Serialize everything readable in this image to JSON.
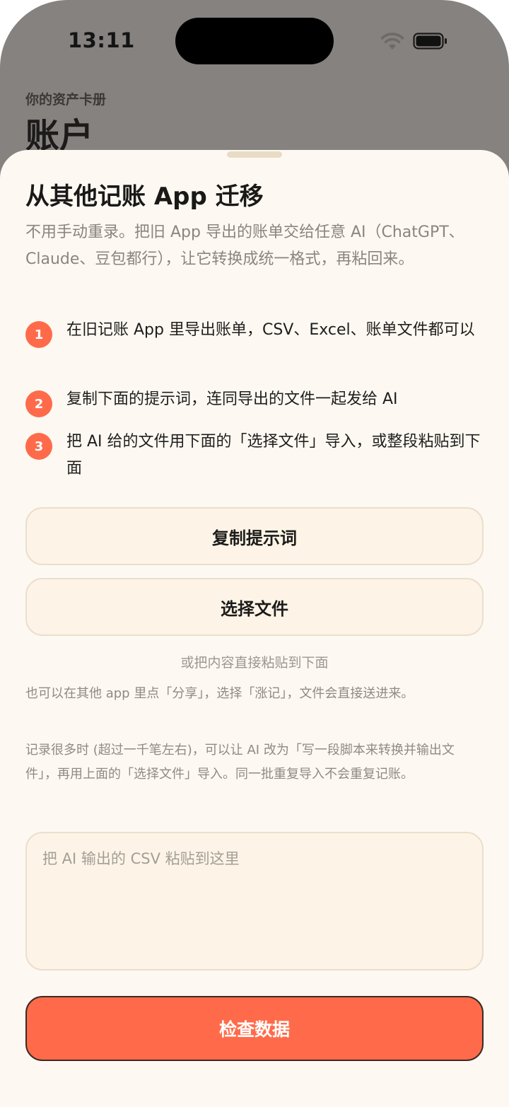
{
  "status_bar": {
    "time": "13:11"
  },
  "background_page": {
    "subtitle": "你的资产卡册",
    "title": "账户"
  },
  "sheet": {
    "title": "从其他记账 App 迁移",
    "intro": "不用手动重录。把旧 App 导出的账单交给任意 AI（ChatGPT、Claude、豆包都行），让它转换成统一格式，再粘回来。",
    "steps": [
      {
        "num": "1",
        "text": "在旧记账 App 里导出账单，CSV、Excel、账单文件都可以"
      },
      {
        "num": "2",
        "text": "复制下面的提示词，连同导出的文件一起发给 AI"
      },
      {
        "num": "3",
        "text": "把 AI 给的文件用下面的「选择文件」导入，或整段粘贴到下面"
      }
    ],
    "copy_prompt_label": "复制提示词",
    "choose_file_label": "选择文件",
    "paste_hint": "或把内容直接粘贴到下面",
    "share_note": "也可以在其他 app 里点「分享」，选择「涨记」，文件会直接送进来。",
    "large_note": "记录很多时 (超过一千笔左右)，可以让 AI 改为「写一段脚本来转换并输出文件」，再用上面的「选择文件」导入。同一批重复导入不会重复记账。",
    "paste_placeholder": "把 AI 输出的 CSV 粘贴到这里",
    "check_label": "检查数据"
  },
  "colors": {
    "accent": "#ff6b4a",
    "sheet_bg": "#fdf9f2",
    "button_bg": "#fdf4e7"
  }
}
